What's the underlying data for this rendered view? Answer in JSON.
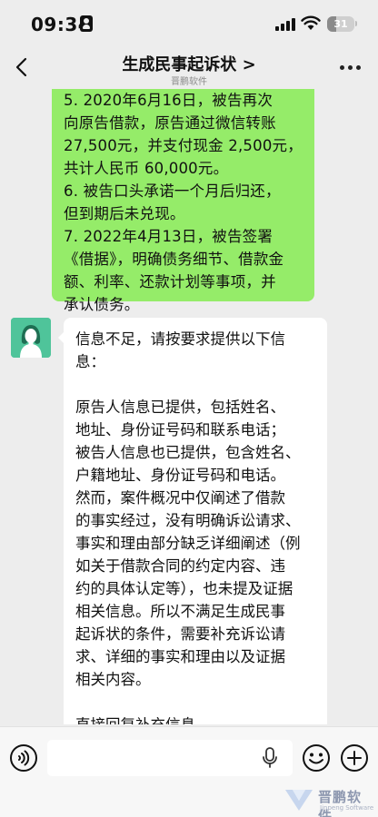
{
  "status_bar": {
    "time": "09:34",
    "battery": "31"
  },
  "nav": {
    "title": "生成民事起诉状 >",
    "subtitle": "晋鹏软件"
  },
  "messages": {
    "sent": {
      "lines": [
        "5.  2020年6月16日，被告再次",
        "向原告借款，原告通过微信转账",
        "27,500元，并支付现金 2,500元，",
        "共计人民币 60,000元。",
        "6.  被告口头承诺一个月后归还，",
        "但到期后未兑现。",
        "7.  2022年4月13日，被告签署",
        "《借据》，明确债务细节、借款金",
        "额、利率、还款计划等事项，并",
        "承认债务。"
      ]
    },
    "received": {
      "para1": [
        "信息不足，请按要求提供以下信",
        "息："
      ],
      "para2": [
        "原告人信息已提供，包括姓名、",
        "地址、身份证号码和联系电话；",
        "被告人信息也已提供，包含姓名、",
        "户籍地址、身份证号码和电话。",
        "然而，案件概况中仅阐述了借款",
        "的事实经过，没有明确诉讼请求、",
        "事实和理由部分缺乏详细阐述（例",
        "如关于借款合同的约定内容、违",
        "约的具体认定等），也未提及证据",
        "相关信息。所以不满足生成民事",
        "起诉状的条件，需要补充诉讼请",
        "求、详细的事实和理由以及证据",
        "相关内容。"
      ],
      "para3": [
        "直接回复补充信息"
      ]
    }
  },
  "input_bar": {
    "value": "",
    "placeholder": ""
  },
  "watermark": {
    "text": "晋鹏软件",
    "en": "Jinpeng Software"
  },
  "colors": {
    "background": "#ededed",
    "sent_bubble": "#95ec69",
    "received_bubble": "#ffffff",
    "avatar": "#4fc49a"
  },
  "icons": [
    "user-badge-icon",
    "signal-icon",
    "wifi-icon",
    "battery-icon",
    "back-icon",
    "more-icon",
    "avatar-icon",
    "voice-icon",
    "mic-icon",
    "emoji-icon",
    "plus-icon",
    "watermark-logo-icon"
  ]
}
